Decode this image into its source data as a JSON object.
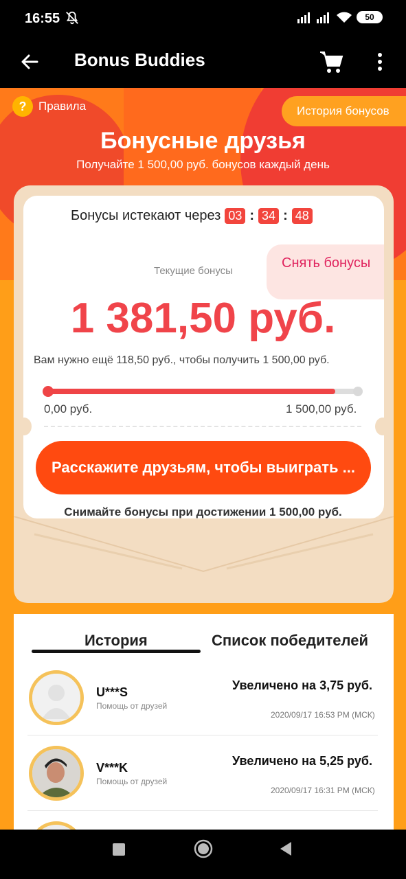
{
  "status_bar": {
    "time": "16:55",
    "battery": "50",
    "icons": [
      "mute-icon",
      "signal-icon",
      "signal-icon",
      "wifi-icon",
      "battery-icon"
    ]
  },
  "app_bar": {
    "title": "Bonus Buddies",
    "icons": [
      "back-arrow-icon",
      "cart-icon",
      "more-vert-icon"
    ]
  },
  "hero": {
    "rules_label": "Правила",
    "rules_icon": "?",
    "history_bonus_label": "История бонусов",
    "title": "Бонусные друзья",
    "subtitle": "Получайте 1 500,00 руб. бонусов каждый день"
  },
  "card": {
    "expire_label": "Бонусы истекают через",
    "timer": {
      "hours": "03",
      "minutes": "34",
      "seconds": "48"
    },
    "current_label": "Текущие бонусы",
    "withdraw_label": "Снять бонусы",
    "amount": "1 381,50 руб.",
    "need_text": "Вам нужно ещё 118,50 руб., чтобы получить 1 500,00 руб.",
    "progress_fraction": 0.921,
    "range_min": "0,00 руб.",
    "range_max": "1 500,00 руб.",
    "share_label": "Расскажите друзьям, чтобы выиграть ...",
    "withdraw_note": "Снимайте бонусы при достижении 1 500,00 руб."
  },
  "tabs": {
    "history": "История",
    "winners": "Список победителей"
  },
  "history": [
    {
      "name": "U***S",
      "source": "Помощь от друзей",
      "gain": "Увеличено на 3,75 руб.",
      "time": "2020/09/17 16:53 PM (МСК)"
    },
    {
      "name": "V***K",
      "source": "Помощь от друзей",
      "gain": "Увеличено на 5,25 руб.",
      "time": "2020/09/17 16:31 PM (МСК)"
    }
  ],
  "colors": {
    "accent": "#ff4a10",
    "amount": "#f0444a",
    "background": "#ff9e18",
    "envelope": "#f3ddc2"
  }
}
